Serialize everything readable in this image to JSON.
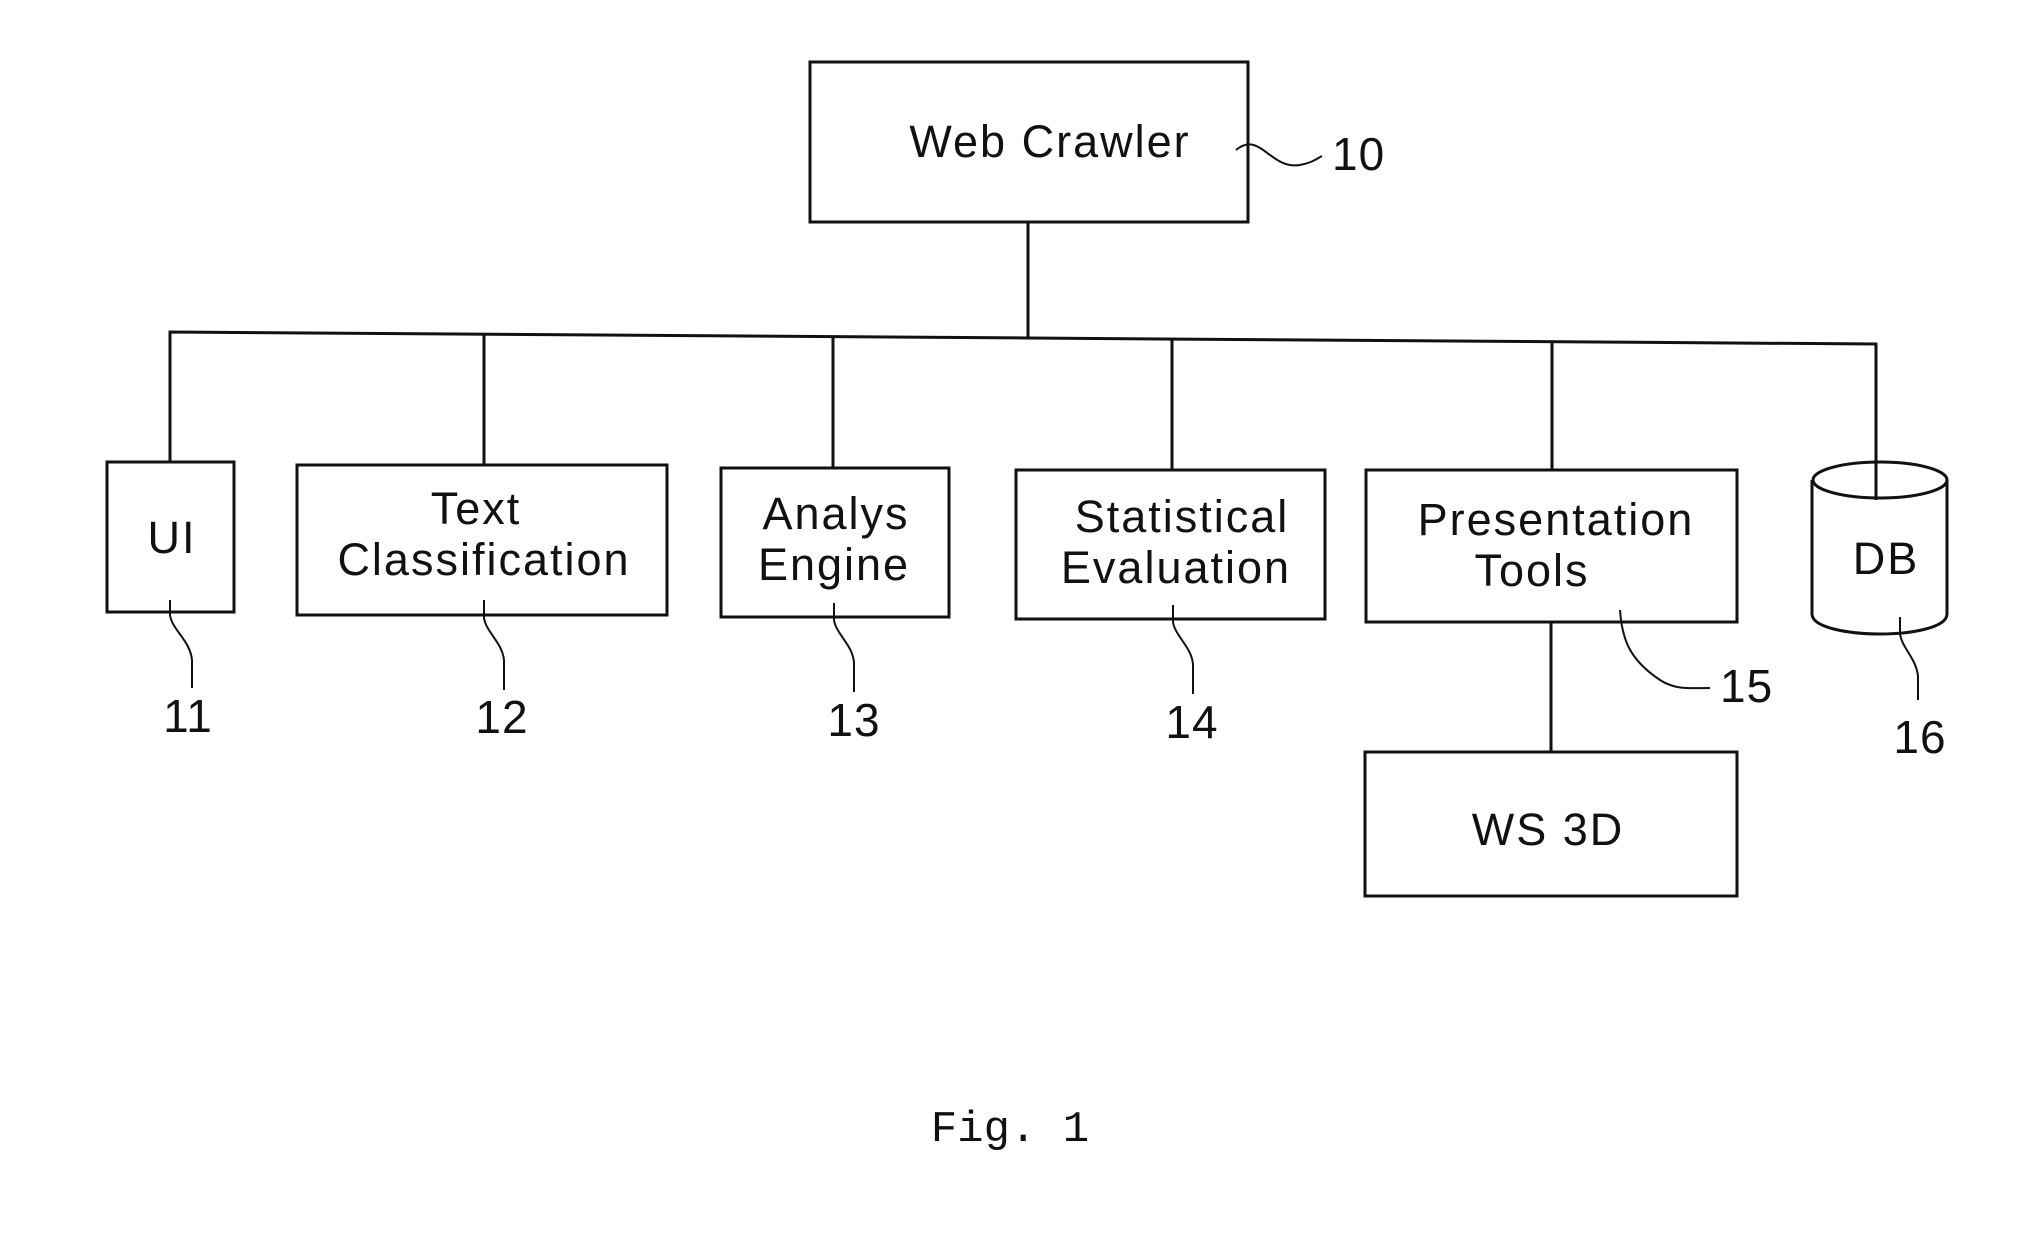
{
  "figure": {
    "caption": "Fig. 1",
    "root": {
      "id": "web-crawler",
      "label": [
        "Web Crawler"
      ],
      "ref": "10"
    },
    "children": [
      {
        "id": "ui",
        "label": [
          "UI"
        ],
        "ref": "11",
        "shape": "box"
      },
      {
        "id": "text-classification",
        "label": [
          "Text",
          "Classification"
        ],
        "ref": "12",
        "shape": "box"
      },
      {
        "id": "analys-engine",
        "label": [
          "Analys",
          "Engine"
        ],
        "ref": "13",
        "shape": "box"
      },
      {
        "id": "statistical-evaluation",
        "label": [
          "Statistical",
          "Evaluation"
        ],
        "ref": "14",
        "shape": "box"
      },
      {
        "id": "presentation-tools",
        "label": [
          "Presentation",
          "Tools"
        ],
        "ref": "15",
        "shape": "box"
      },
      {
        "id": "db",
        "label": [
          "DB"
        ],
        "ref": "16",
        "shape": "cylinder"
      }
    ],
    "sub_children": [
      {
        "id": "ws-3d",
        "parent": "presentation-tools",
        "label": [
          "WS 3D"
        ]
      }
    ],
    "edges": [
      [
        "web-crawler",
        "ui"
      ],
      [
        "web-crawler",
        "text-classification"
      ],
      [
        "web-crawler",
        "analys-engine"
      ],
      [
        "web-crawler",
        "statistical-evaluation"
      ],
      [
        "web-crawler",
        "presentation-tools"
      ],
      [
        "web-crawler",
        "db"
      ],
      [
        "presentation-tools",
        "ws-3d"
      ]
    ]
  }
}
